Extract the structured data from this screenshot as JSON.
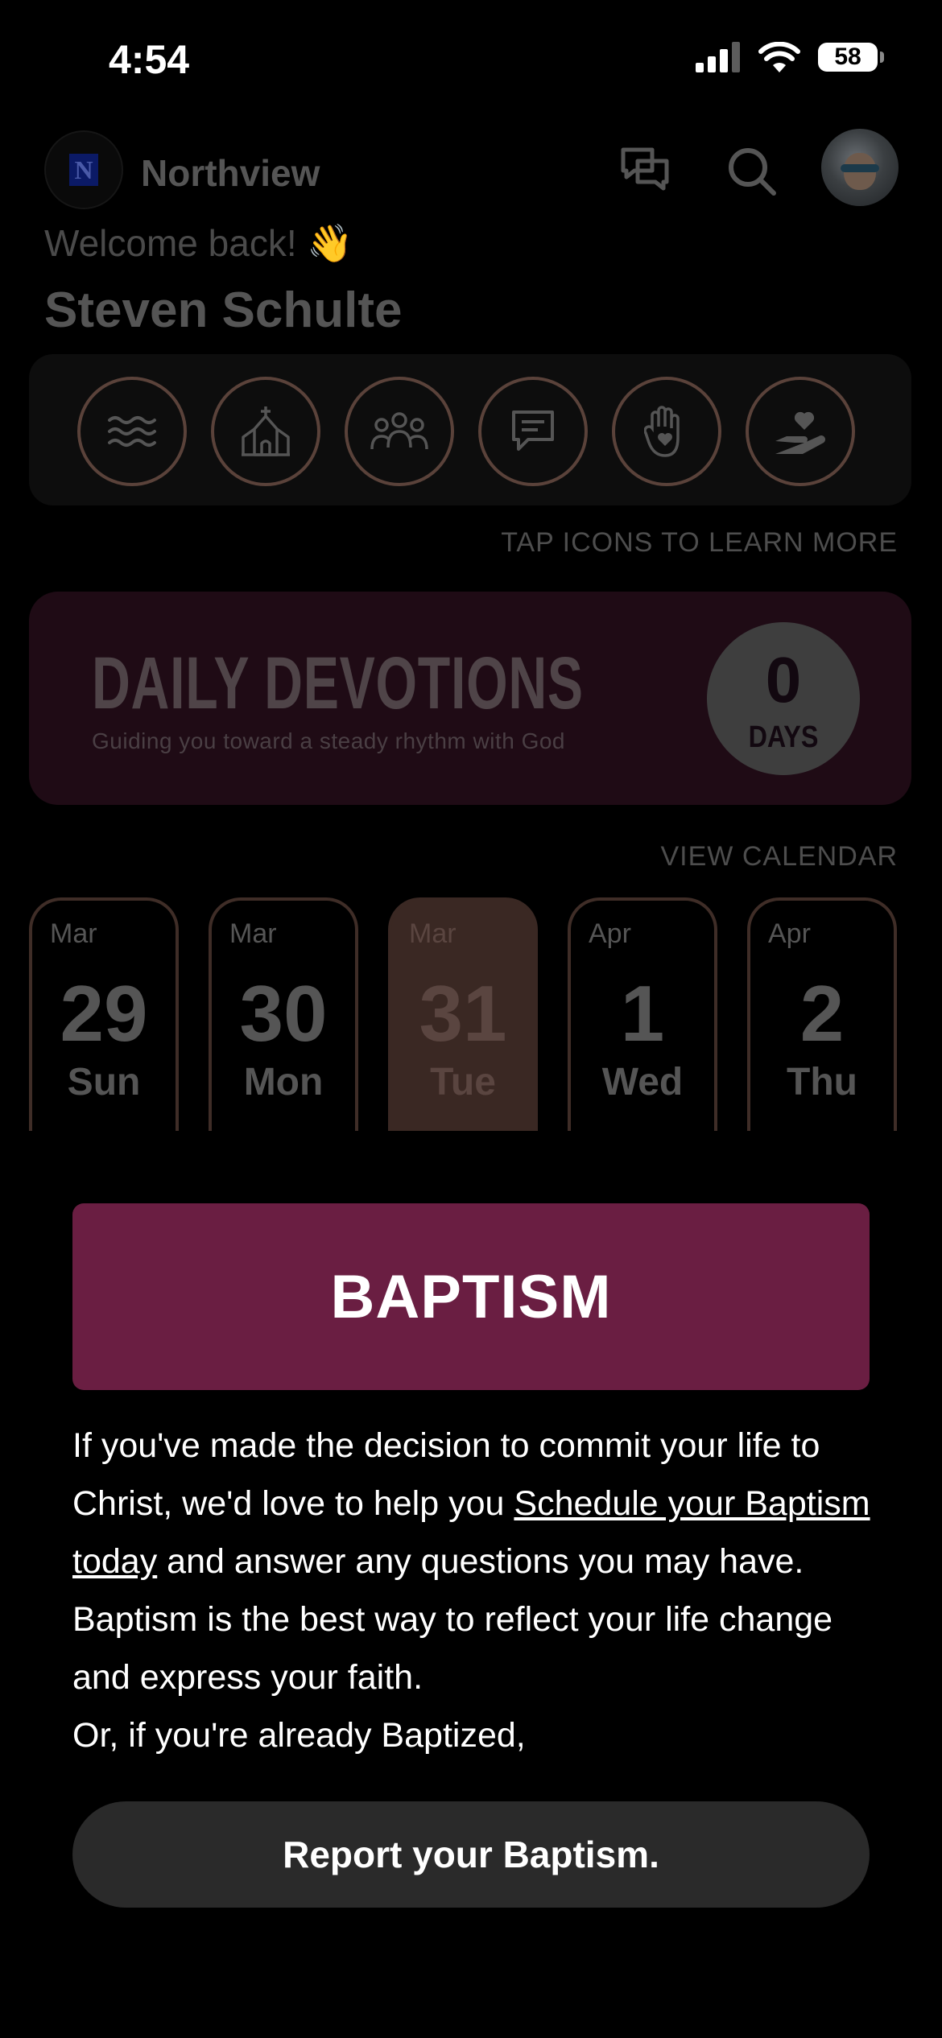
{
  "status_bar": {
    "time": "4:54",
    "battery": "58"
  },
  "header": {
    "brand_name": "Northview",
    "logo_letter": "N",
    "welcome": "Welcome back! 👋",
    "user_name": "Steven Schulte"
  },
  "quick_icons": [
    "waves-icon",
    "church-icon",
    "group-icon",
    "chat-bubble-icon",
    "raised-hand-icon",
    "heart-in-hand-icon"
  ],
  "tap_hint": "TAP ICONS TO LEARN MORE",
  "devotions": {
    "title": "DAILY DEVOTIONS",
    "subtitle": "Guiding you toward a steady rhythm with God",
    "count": "0",
    "count_label": "DAYS"
  },
  "view_calendar": "VIEW CALENDAR",
  "calendar_days": [
    {
      "month": "Mar",
      "day": "29",
      "weekday": "Sun",
      "selected": false
    },
    {
      "month": "Mar",
      "day": "30",
      "weekday": "Mon",
      "selected": false
    },
    {
      "month": "Mar",
      "day": "31",
      "weekday": "Tue",
      "selected": true
    },
    {
      "month": "Apr",
      "day": "1",
      "weekday": "Wed",
      "selected": false
    },
    {
      "month": "Apr",
      "day": "2",
      "weekday": "Thu",
      "selected": false
    }
  ],
  "modal": {
    "banner_title": "BAPTISM",
    "text_before_link": "If you've made the decision to commit your life to Christ, we'd love to help you ",
    "link_text": "Schedule your Baptism today",
    "text_after_link": " and answer any questions you may have. Baptism is the best way to reflect your life change and express your faith.",
    "text_line2": "Or, if you're already Baptized,",
    "button_label": "Report your Baptism."
  },
  "colors": {
    "banner": "#6a1e42",
    "devotion_bg": "#1f0b15",
    "accent_ring": "#5a423a",
    "button_bg": "#2a2a2a"
  }
}
